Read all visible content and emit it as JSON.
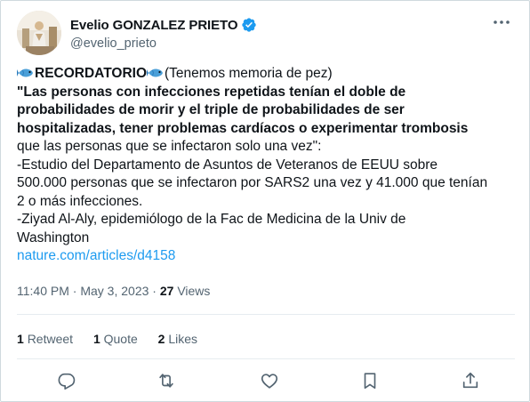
{
  "author": {
    "name": "Evelio GONZALEZ PRIETO",
    "handle": "@evelio_prieto",
    "verified_color": "#1d9bf0"
  },
  "tweet": {
    "line1_bold": "RECORDATORIO",
    "line1_rest": "(Tenemos memoria de pez)",
    "quote_lines": [
      "\"Las personas con infecciones repetidas tenían el doble de",
      "probabilidades de morir y el triple de probabilidades de ser",
      "hospitalizadas, tener problemas cardíacos o experimentar trombosis"
    ],
    "plain_lines": [
      "que las personas que se infectaron solo una vez\":",
      "-Estudio del Departamento de Asuntos de Veteranos de EEUU sobre",
      "500.000 personas que se infectaron por SARS2 una vez y 41.000 que tenían",
      "2 o más infecciones.",
      "-Ziyad Al-Aly, epidemiólogo de la Fac de Medicina de la Univ de",
      "Washington"
    ],
    "link": "nature.com/articles/d4158",
    "link_color": "#1d9bf0"
  },
  "meta": {
    "time": "11:40 PM",
    "separator": " · ",
    "date": "May 3, 2023",
    "views_count": "27",
    "views_label": " Views"
  },
  "stats": {
    "retweets_count": "1",
    "retweets_label": "Retweet",
    "quotes_count": "1",
    "quotes_label": "Quote",
    "likes_count": "2",
    "likes_label": "Likes"
  },
  "icons": {
    "fish": "fish-icon",
    "verified": "verified-badge-icon",
    "more": "more-options-icon",
    "reply": "reply-icon",
    "retweet": "retweet-icon",
    "like": "heart-icon",
    "bookmark": "bookmark-icon",
    "share": "share-icon"
  },
  "colors": {
    "text": "#0f1419",
    "secondary": "#536471",
    "border": "#cfd9de"
  }
}
